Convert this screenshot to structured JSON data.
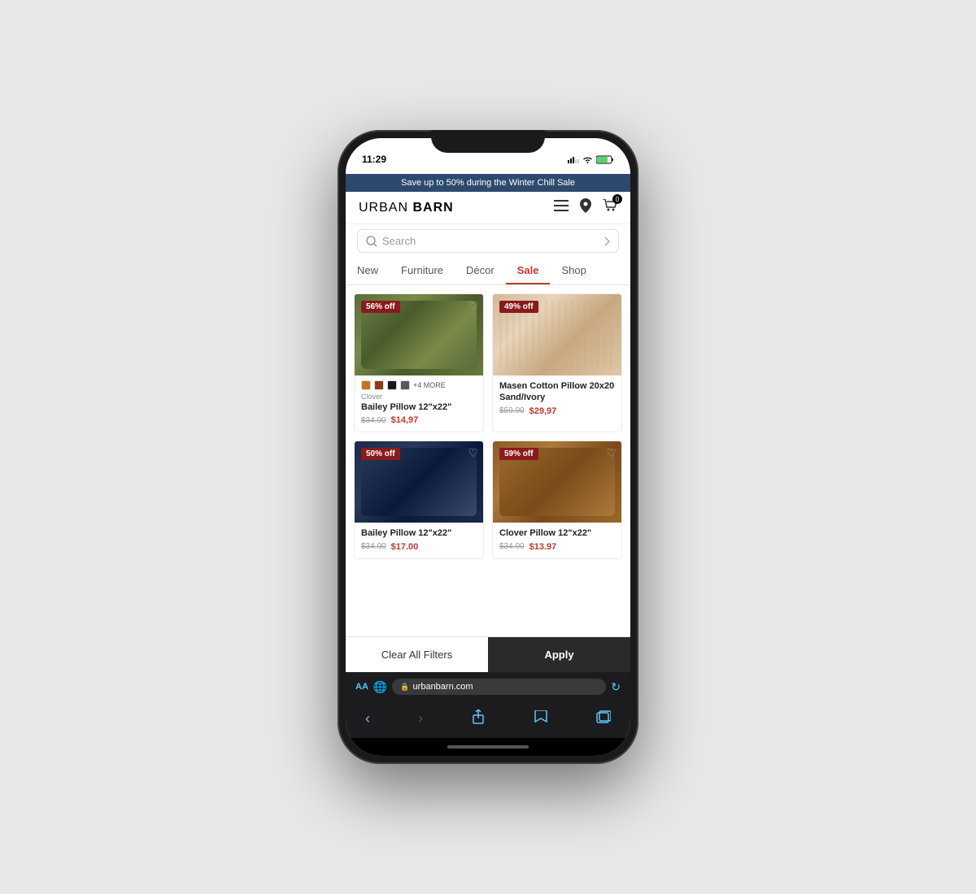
{
  "phone": {
    "status": {
      "time": "11:29",
      "battery_level": "80"
    }
  },
  "promo_banner": {
    "text": "Save up to 50% during the Winter Chill Sale"
  },
  "header": {
    "logo": "URBAN BARN",
    "logo_part1": "URBAN",
    "logo_part2": "BARN",
    "cart_count": "0"
  },
  "search": {
    "placeholder": "Search"
  },
  "nav": {
    "tabs": [
      {
        "label": "New",
        "active": false
      },
      {
        "label": "Furniture",
        "active": false
      },
      {
        "label": "Décor",
        "active": false
      },
      {
        "label": "Sale",
        "active": true
      },
      {
        "label": "Shop",
        "active": false
      }
    ]
  },
  "products": [
    {
      "id": "p1",
      "discount": "56% off",
      "label": "Clover",
      "name": "Bailey Pillow 12\"x22\"",
      "price_original": "$34.00",
      "price_sale": "$14.97",
      "colors": [
        "#c4741a",
        "#8b3a1a",
        "#1a1a1a",
        "#5a5a5a"
      ],
      "more_colors": "+4 MORE",
      "style": "clover"
    },
    {
      "id": "p2",
      "discount": "49% off",
      "label": "",
      "name": "Masen Cotton Pillow 20x20 Sand/Ivory",
      "price_original": "$59.00",
      "price_sale": "$29.97",
      "colors": [],
      "more_colors": "",
      "style": "sand"
    },
    {
      "id": "p3",
      "discount": "50% off",
      "label": "",
      "name": "Bailey Pillow 12\"x22\"",
      "price_original": "$34.00",
      "price_sale": "$17.00",
      "colors": [],
      "more_colors": "",
      "style": "navy"
    },
    {
      "id": "p4",
      "discount": "59% off",
      "label": "",
      "name": "Clover Pillow 12\"x22\"",
      "price_original": "$34.00",
      "price_sale": "$13.97",
      "colors": [],
      "more_colors": "",
      "style": "rust"
    }
  ],
  "filter_bar": {
    "clear_label": "Clear All Filters",
    "apply_label": "Apply"
  },
  "browser": {
    "url": "urbanbarn.com",
    "aa_label": "AA"
  }
}
